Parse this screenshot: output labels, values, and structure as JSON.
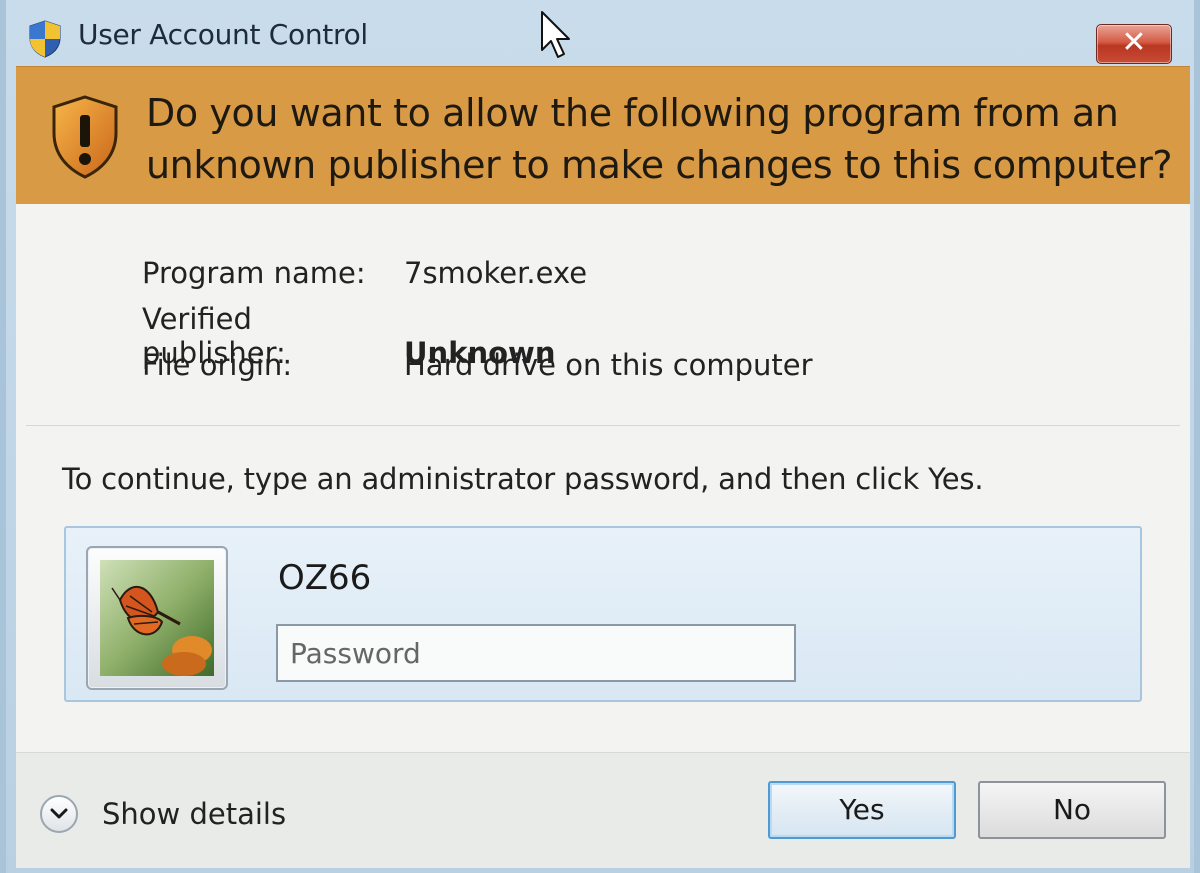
{
  "window": {
    "title": "User Account Control",
    "close_glyph": "✕"
  },
  "banner": {
    "question": "Do you want to allow the following program from an unknown publisher to make changes to this computer?"
  },
  "program_info": {
    "program_name_label": "Program name:",
    "program_name_value": "7smoker.exe",
    "publisher_label": "Verified publisher:",
    "publisher_value": "Unknown",
    "origin_label": "File origin:",
    "origin_value": "Hard drive on this computer"
  },
  "credentials": {
    "instruction": "To continue, type an administrator password, and then click Yes.",
    "username": "OZ66",
    "password_value": "",
    "password_placeholder": "Password",
    "avatar_icon": "butterfly-avatar"
  },
  "footer": {
    "show_details_label": "Show details",
    "yes_label": "Yes",
    "no_label": "No"
  },
  "colors": {
    "banner": "#d99a46",
    "close_button": "#c94c35",
    "default_button_border": "#4f9ad3"
  },
  "icons": {
    "title_icon": "uac-shield-icon",
    "banner_icon": "warning-shield-icon",
    "details_icon": "chevron-down-icon",
    "cursor": "mouse-pointer-icon"
  }
}
